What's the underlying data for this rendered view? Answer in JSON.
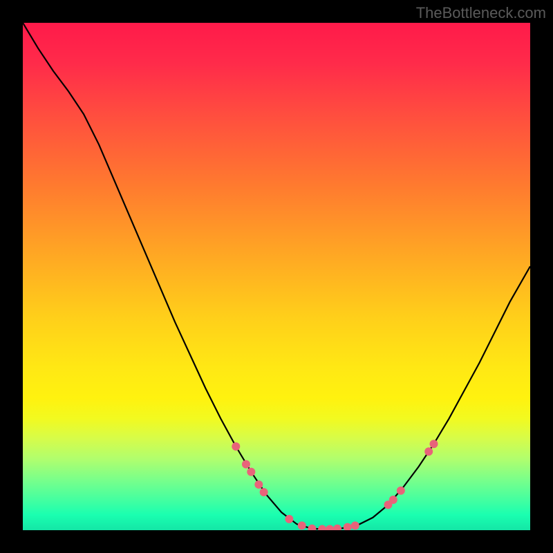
{
  "watermark": "TheBottleneck.com",
  "chart_data": {
    "type": "line",
    "title": "",
    "xlabel": "",
    "ylabel": "",
    "xlim": [
      0,
      100
    ],
    "ylim": [
      0,
      100
    ],
    "curve": [
      {
        "x": 0.0,
        "y": 100.0
      },
      {
        "x": 3.0,
        "y": 95.0
      },
      {
        "x": 6.0,
        "y": 90.5
      },
      {
        "x": 9.0,
        "y": 86.5
      },
      {
        "x": 12.0,
        "y": 82.0
      },
      {
        "x": 15.0,
        "y": 76.0
      },
      {
        "x": 18.0,
        "y": 69.0
      },
      {
        "x": 21.0,
        "y": 62.0
      },
      {
        "x": 24.0,
        "y": 55.0
      },
      {
        "x": 27.0,
        "y": 48.0
      },
      {
        "x": 30.0,
        "y": 41.0
      },
      {
        "x": 33.0,
        "y": 34.5
      },
      {
        "x": 36.0,
        "y": 28.0
      },
      {
        "x": 39.0,
        "y": 22.0
      },
      {
        "x": 42.0,
        "y": 16.5
      },
      {
        "x": 45.0,
        "y": 11.5
      },
      {
        "x": 48.0,
        "y": 7.0
      },
      {
        "x": 51.0,
        "y": 3.5
      },
      {
        "x": 54.0,
        "y": 1.2
      },
      {
        "x": 57.0,
        "y": 0.3
      },
      {
        "x": 60.0,
        "y": 0.2
      },
      {
        "x": 63.0,
        "y": 0.4
      },
      {
        "x": 66.0,
        "y": 1.0
      },
      {
        "x": 69.0,
        "y": 2.5
      },
      {
        "x": 72.0,
        "y": 5.0
      },
      {
        "x": 75.0,
        "y": 8.5
      },
      {
        "x": 78.0,
        "y": 12.5
      },
      {
        "x": 81.0,
        "y": 17.0
      },
      {
        "x": 84.0,
        "y": 22.0
      },
      {
        "x": 87.0,
        "y": 27.5
      },
      {
        "x": 90.0,
        "y": 33.0
      },
      {
        "x": 93.0,
        "y": 39.0
      },
      {
        "x": 96.0,
        "y": 45.0
      },
      {
        "x": 100.0,
        "y": 52.0
      }
    ],
    "markers": [
      {
        "x": 42.0,
        "y": 16.5
      },
      {
        "x": 44.0,
        "y": 13.0
      },
      {
        "x": 45.0,
        "y": 11.5
      },
      {
        "x": 46.5,
        "y": 9.0
      },
      {
        "x": 47.5,
        "y": 7.5
      },
      {
        "x": 52.5,
        "y": 2.2
      },
      {
        "x": 55.0,
        "y": 0.9
      },
      {
        "x": 57.0,
        "y": 0.3
      },
      {
        "x": 59.0,
        "y": 0.2
      },
      {
        "x": 60.5,
        "y": 0.2
      },
      {
        "x": 62.0,
        "y": 0.3
      },
      {
        "x": 64.0,
        "y": 0.6
      },
      {
        "x": 65.5,
        "y": 0.9
      },
      {
        "x": 72.0,
        "y": 5.0
      },
      {
        "x": 73.0,
        "y": 6.0
      },
      {
        "x": 74.5,
        "y": 7.8
      },
      {
        "x": 80.0,
        "y": 15.5
      },
      {
        "x": 81.0,
        "y": 17.0
      }
    ],
    "marker_color": "#e8637a",
    "curve_color": "#000000",
    "gradient_stops": [
      {
        "pos": 0.0,
        "color": "#ff1a4a"
      },
      {
        "pos": 0.18,
        "color": "#ff4d3f"
      },
      {
        "pos": 0.45,
        "color": "#ffa524"
      },
      {
        "pos": 0.74,
        "color": "#fff20f"
      },
      {
        "pos": 0.9,
        "color": "#7aff8a"
      },
      {
        "pos": 1.0,
        "color": "#14e6a6"
      }
    ]
  }
}
